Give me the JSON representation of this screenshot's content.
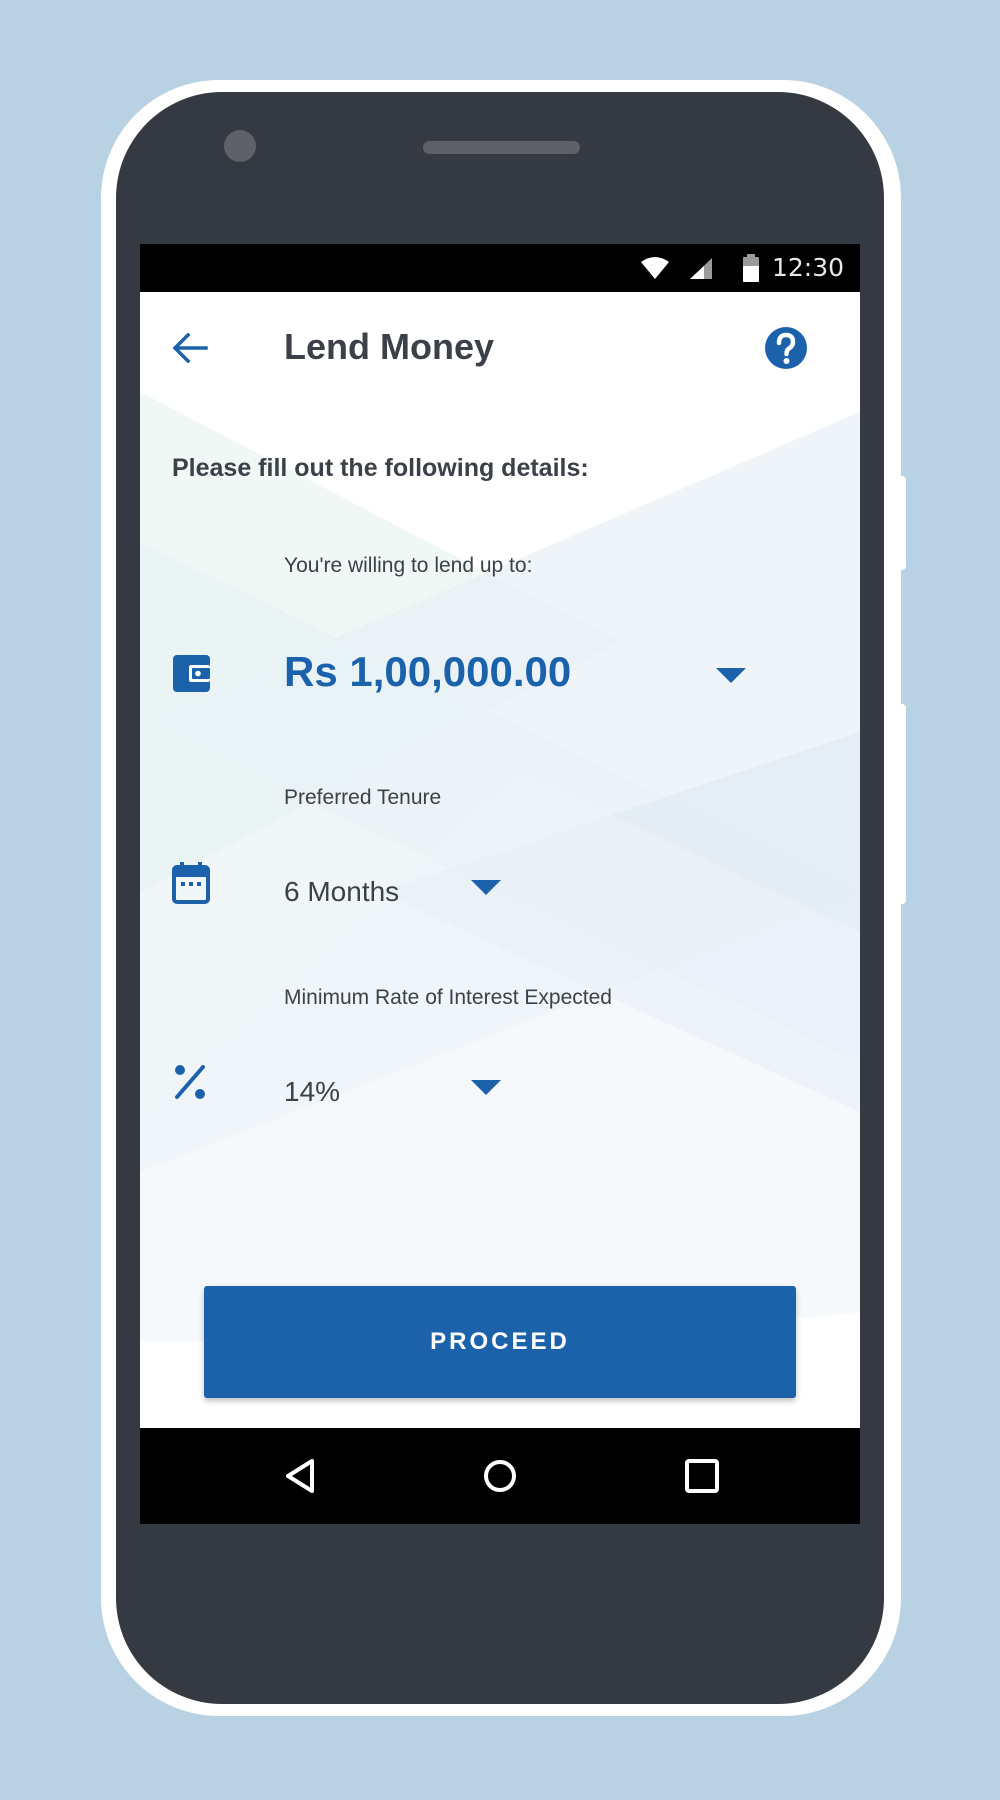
{
  "status_bar": {
    "time": "12:30",
    "icons": [
      "wifi-icon",
      "cell-signal-icon",
      "battery-icon"
    ]
  },
  "app_bar": {
    "title": "Lend Money",
    "back_icon": "arrow-back-icon",
    "help_icon": "help-circle-icon"
  },
  "form": {
    "heading": "Please fill out the following details:",
    "fields": [
      {
        "label": "You're willing to lend up to:",
        "value": "Rs 1,00,000.00",
        "icon": "wallet-icon"
      },
      {
        "label": "Preferred Tenure",
        "value": "6 Months",
        "icon": "calendar-icon"
      },
      {
        "label": "Minimum Rate of Interest Expected",
        "value": "14%",
        "icon": "percent-icon"
      }
    ]
  },
  "proceed_button": {
    "label": "PROCEED"
  },
  "nav_bar": {
    "icons": [
      "nav-back-icon",
      "nav-home-icon",
      "nav-recents-icon"
    ]
  },
  "colors": {
    "background": "#b8d1e3",
    "phone_body": "#353a42",
    "accent": "#1b62ab",
    "text": "#3c4149"
  }
}
